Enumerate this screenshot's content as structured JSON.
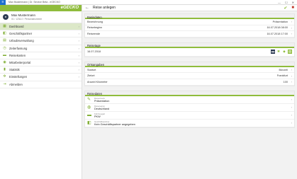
{
  "window": {
    "title": "Max Mustermann | Dr. Service Beta - eGECKO",
    "controls": [
      "—",
      "☐",
      "✕"
    ]
  },
  "brand": {
    "logo": "eGECKO",
    "color": "#8fbc3c"
  },
  "profile": {
    "name": "Max Mustermann",
    "subtitle": "01 / 1234-0 / Personalnummer",
    "initials": ""
  },
  "sidebar": {
    "items": [
      {
        "label": "Dashboard",
        "icon": "home-icon",
        "active": true
      },
      {
        "label": "Geschäftspartner",
        "icon": "users-icon"
      },
      {
        "label": "Urlaubsverwaltung",
        "icon": "calendar-icon"
      },
      {
        "label": "Zeiterfassung",
        "icon": "clock-icon"
      },
      {
        "label": "Reisekosten",
        "icon": "car-icon"
      },
      {
        "label": "Mitarbeiterportal",
        "icon": "person-icon"
      },
      {
        "label": "Statistik",
        "icon": "chart-icon"
      },
      {
        "label": "Einstellungen",
        "icon": "gear-icon"
      },
      {
        "label": "Abmelden",
        "icon": "logout-icon"
      }
    ]
  },
  "header": {
    "title": "Reise anlegen"
  },
  "basis": {
    "heading": "Basisdaten",
    "rows": [
      {
        "label": "Bezeichnung",
        "value": "Präsentation"
      },
      {
        "label": "Reisebeginn",
        "value": "16.07.2018 08:00"
      },
      {
        "label": "Reiseende",
        "value": "16.07.2018 17:00"
      }
    ]
  },
  "days": {
    "heading": "Reisetage",
    "rows": [
      {
        "label": "16.07.2018"
      }
    ]
  },
  "places": {
    "heading": "Ortsangaben",
    "rows": [
      {
        "label": "Startort",
        "value": "Bünzell"
      },
      {
        "label": "Zielort",
        "value": "Frankfurt"
      },
      {
        "label": "Anzahl Kilometer",
        "value": "100"
      }
    ]
  },
  "details": {
    "heading": "Reisedaten",
    "rows": [
      {
        "small": "Reisezweck",
        "main": "Präsentation",
        "icon": "pencil-icon"
      },
      {
        "small": "Reiseregion",
        "main": "Deutschland",
        "icon": "globe-icon"
      },
      {
        "small": "Fahrzeugart",
        "main": "PKW",
        "icon": "car-icon"
      },
      {
        "small": "Geschäftspartner",
        "main": "Kein Geschäftspartner angegeben",
        "icon": "partner-icon"
      }
    ]
  }
}
